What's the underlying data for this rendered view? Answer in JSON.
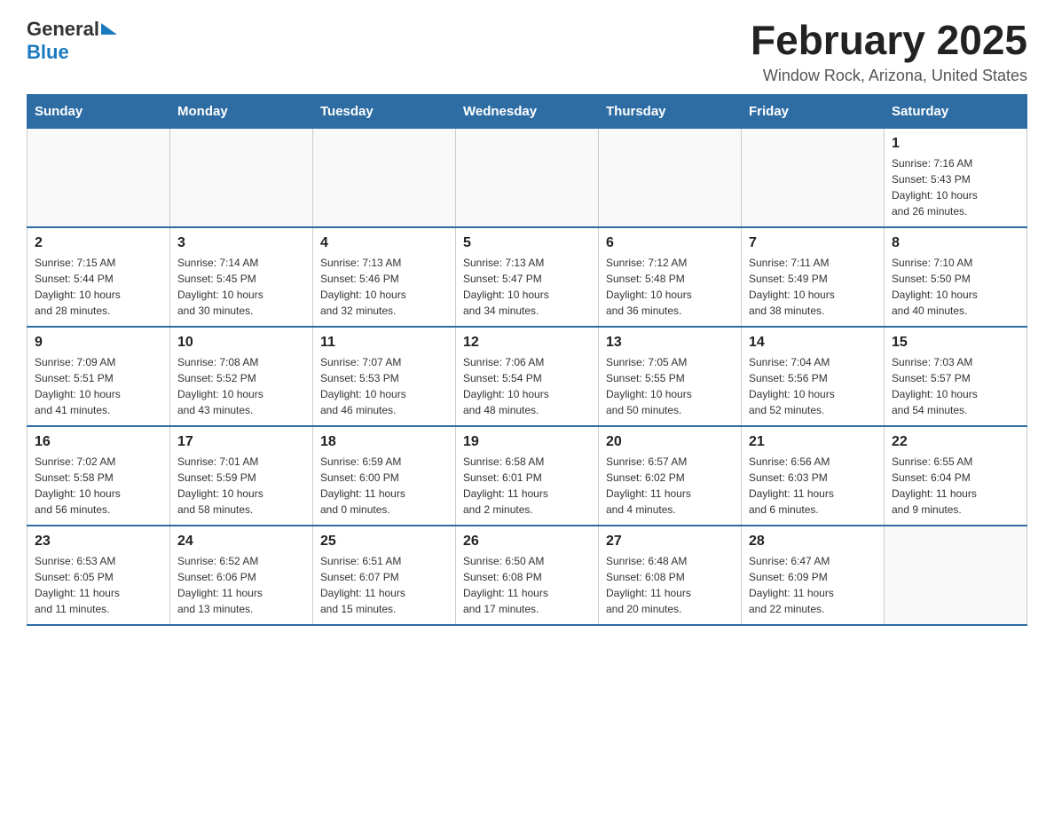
{
  "header": {
    "logo_general": "General",
    "logo_blue": "Blue",
    "month_title": "February 2025",
    "location": "Window Rock, Arizona, United States"
  },
  "days_of_week": [
    "Sunday",
    "Monday",
    "Tuesday",
    "Wednesday",
    "Thursday",
    "Friday",
    "Saturday"
  ],
  "weeks": [
    [
      {
        "day": "",
        "info": ""
      },
      {
        "day": "",
        "info": ""
      },
      {
        "day": "",
        "info": ""
      },
      {
        "day": "",
        "info": ""
      },
      {
        "day": "",
        "info": ""
      },
      {
        "day": "",
        "info": ""
      },
      {
        "day": "1",
        "info": "Sunrise: 7:16 AM\nSunset: 5:43 PM\nDaylight: 10 hours\nand 26 minutes."
      }
    ],
    [
      {
        "day": "2",
        "info": "Sunrise: 7:15 AM\nSunset: 5:44 PM\nDaylight: 10 hours\nand 28 minutes."
      },
      {
        "day": "3",
        "info": "Sunrise: 7:14 AM\nSunset: 5:45 PM\nDaylight: 10 hours\nand 30 minutes."
      },
      {
        "day": "4",
        "info": "Sunrise: 7:13 AM\nSunset: 5:46 PM\nDaylight: 10 hours\nand 32 minutes."
      },
      {
        "day": "5",
        "info": "Sunrise: 7:13 AM\nSunset: 5:47 PM\nDaylight: 10 hours\nand 34 minutes."
      },
      {
        "day": "6",
        "info": "Sunrise: 7:12 AM\nSunset: 5:48 PM\nDaylight: 10 hours\nand 36 minutes."
      },
      {
        "day": "7",
        "info": "Sunrise: 7:11 AM\nSunset: 5:49 PM\nDaylight: 10 hours\nand 38 minutes."
      },
      {
        "day": "8",
        "info": "Sunrise: 7:10 AM\nSunset: 5:50 PM\nDaylight: 10 hours\nand 40 minutes."
      }
    ],
    [
      {
        "day": "9",
        "info": "Sunrise: 7:09 AM\nSunset: 5:51 PM\nDaylight: 10 hours\nand 41 minutes."
      },
      {
        "day": "10",
        "info": "Sunrise: 7:08 AM\nSunset: 5:52 PM\nDaylight: 10 hours\nand 43 minutes."
      },
      {
        "day": "11",
        "info": "Sunrise: 7:07 AM\nSunset: 5:53 PM\nDaylight: 10 hours\nand 46 minutes."
      },
      {
        "day": "12",
        "info": "Sunrise: 7:06 AM\nSunset: 5:54 PM\nDaylight: 10 hours\nand 48 minutes."
      },
      {
        "day": "13",
        "info": "Sunrise: 7:05 AM\nSunset: 5:55 PM\nDaylight: 10 hours\nand 50 minutes."
      },
      {
        "day": "14",
        "info": "Sunrise: 7:04 AM\nSunset: 5:56 PM\nDaylight: 10 hours\nand 52 minutes."
      },
      {
        "day": "15",
        "info": "Sunrise: 7:03 AM\nSunset: 5:57 PM\nDaylight: 10 hours\nand 54 minutes."
      }
    ],
    [
      {
        "day": "16",
        "info": "Sunrise: 7:02 AM\nSunset: 5:58 PM\nDaylight: 10 hours\nand 56 minutes."
      },
      {
        "day": "17",
        "info": "Sunrise: 7:01 AM\nSunset: 5:59 PM\nDaylight: 10 hours\nand 58 minutes."
      },
      {
        "day": "18",
        "info": "Sunrise: 6:59 AM\nSunset: 6:00 PM\nDaylight: 11 hours\nand 0 minutes."
      },
      {
        "day": "19",
        "info": "Sunrise: 6:58 AM\nSunset: 6:01 PM\nDaylight: 11 hours\nand 2 minutes."
      },
      {
        "day": "20",
        "info": "Sunrise: 6:57 AM\nSunset: 6:02 PM\nDaylight: 11 hours\nand 4 minutes."
      },
      {
        "day": "21",
        "info": "Sunrise: 6:56 AM\nSunset: 6:03 PM\nDaylight: 11 hours\nand 6 minutes."
      },
      {
        "day": "22",
        "info": "Sunrise: 6:55 AM\nSunset: 6:04 PM\nDaylight: 11 hours\nand 9 minutes."
      }
    ],
    [
      {
        "day": "23",
        "info": "Sunrise: 6:53 AM\nSunset: 6:05 PM\nDaylight: 11 hours\nand 11 minutes."
      },
      {
        "day": "24",
        "info": "Sunrise: 6:52 AM\nSunset: 6:06 PM\nDaylight: 11 hours\nand 13 minutes."
      },
      {
        "day": "25",
        "info": "Sunrise: 6:51 AM\nSunset: 6:07 PM\nDaylight: 11 hours\nand 15 minutes."
      },
      {
        "day": "26",
        "info": "Sunrise: 6:50 AM\nSunset: 6:08 PM\nDaylight: 11 hours\nand 17 minutes."
      },
      {
        "day": "27",
        "info": "Sunrise: 6:48 AM\nSunset: 6:08 PM\nDaylight: 11 hours\nand 20 minutes."
      },
      {
        "day": "28",
        "info": "Sunrise: 6:47 AM\nSunset: 6:09 PM\nDaylight: 11 hours\nand 22 minutes."
      },
      {
        "day": "",
        "info": ""
      }
    ]
  ]
}
